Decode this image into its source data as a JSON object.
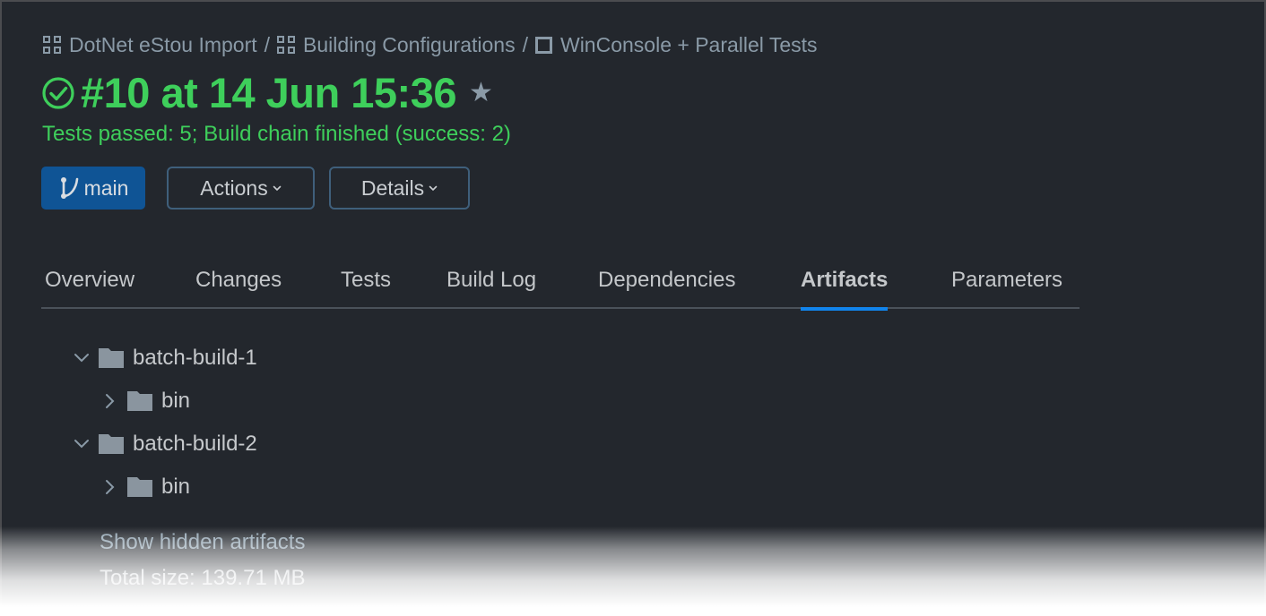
{
  "breadcrumb": [
    {
      "label": "DotNet eStou Import",
      "icon": "project-grid-icon"
    },
    {
      "label": "Building Configurations",
      "icon": "project-grid-icon"
    },
    {
      "label": "WinConsole + Parallel Tests",
      "icon": "build-config-square-icon"
    }
  ],
  "breadcrumb_separator": "/",
  "build": {
    "title": "#10 at 14 Jun 15:36",
    "status_icon": "success-check-circle-icon",
    "favorite_icon": "star-icon",
    "status_text": "Tests passed: 5; Build chain finished (success: 2)"
  },
  "toolbar": {
    "branch_label": "main",
    "branch_icon": "branch-icon",
    "actions_label": "Actions",
    "details_label": "Details"
  },
  "tabs": [
    {
      "label": "Overview",
      "active": false
    },
    {
      "label": "Changes",
      "active": false
    },
    {
      "label": "Tests",
      "active": false
    },
    {
      "label": "Build Log",
      "active": false
    },
    {
      "label": "Dependencies",
      "active": false
    },
    {
      "label": "Artifacts",
      "active": true
    },
    {
      "label": "Parameters",
      "active": false
    }
  ],
  "artifacts": {
    "tree": [
      {
        "name": "batch-build-1",
        "expanded": true,
        "children": [
          {
            "name": "bin",
            "expanded": false
          }
        ]
      },
      {
        "name": "batch-build-2",
        "expanded": true,
        "children": [
          {
            "name": "bin",
            "expanded": false
          }
        ]
      }
    ],
    "show_hidden_label": "Show hidden artifacts",
    "total_size_label": "Total size: 139.71 MB"
  },
  "colors": {
    "background": "#23272d",
    "success": "#3ecf5b",
    "accent": "#1184ec",
    "branch_button": "#0f5495",
    "muted": "#8a9aa7"
  }
}
